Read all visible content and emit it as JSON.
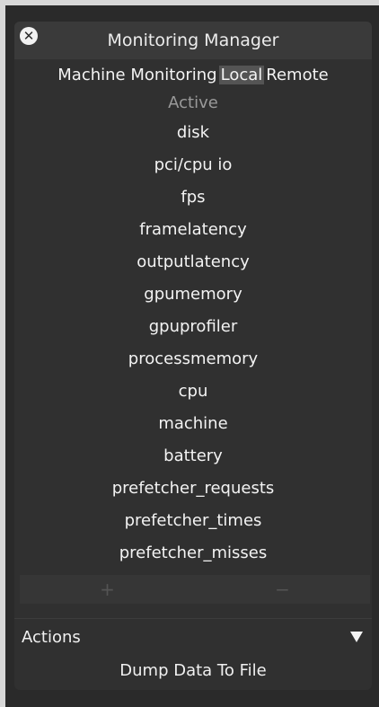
{
  "window": {
    "title": "Monitoring Manager",
    "close_icon": "close-icon"
  },
  "tabs": [
    {
      "label": "Machine Monitoring",
      "selected": false
    },
    {
      "label": "Local",
      "selected": true
    },
    {
      "label": "Remote",
      "selected": false
    }
  ],
  "list_header": "Active",
  "monitors": [
    "disk",
    "pci/cpu io",
    "fps",
    "framelatency",
    "outputlatency",
    "gpumemory",
    "gpuprofiler",
    "processmemory",
    "cpu",
    "machine",
    "battery",
    "prefetcher_requests",
    "prefetcher_times",
    "prefetcher_misses"
  ],
  "controls": {
    "add_label": "+",
    "remove_label": "−"
  },
  "actions": {
    "label": "Actions",
    "dropdown_icon": "triangle-down-icon",
    "button_label": "Dump Data To File"
  }
}
